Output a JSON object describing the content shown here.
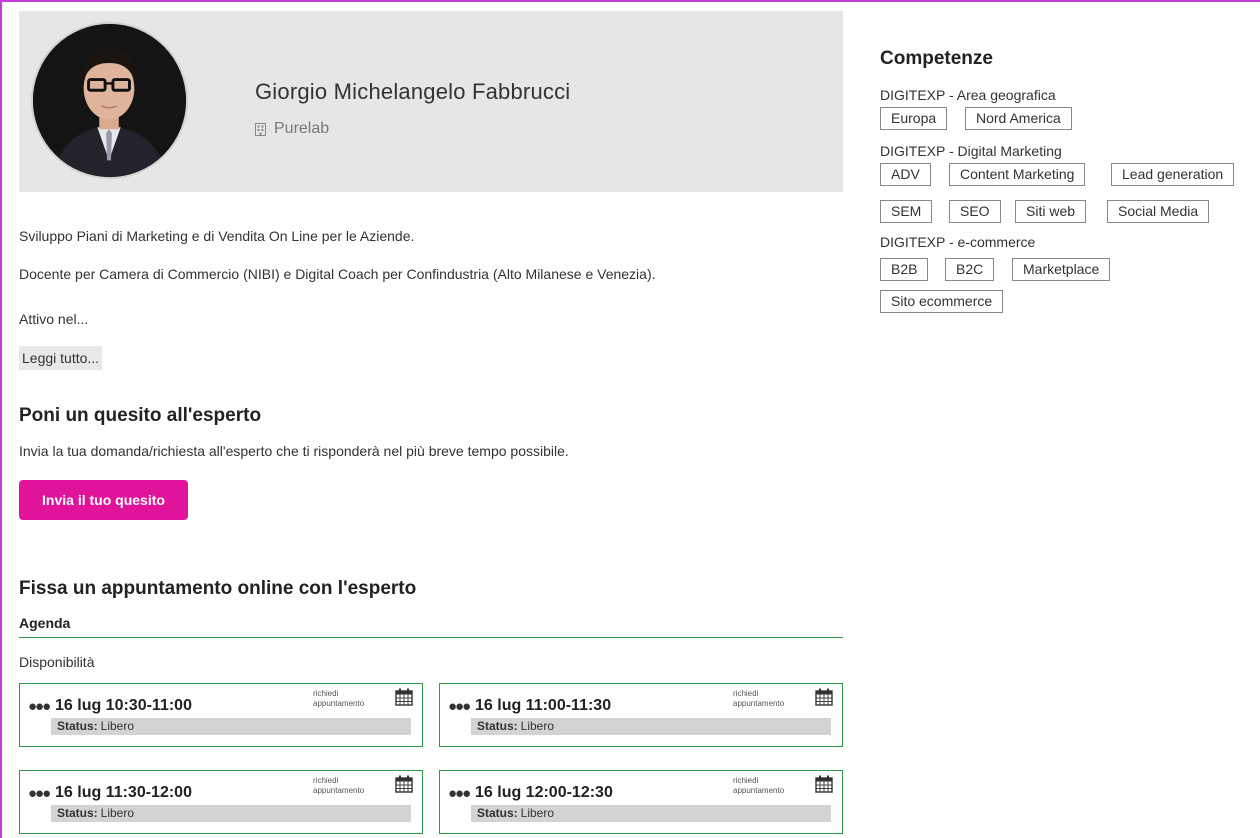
{
  "profile": {
    "name": "Giorgio Michelangelo Fabbrucci",
    "company": "Purelab",
    "company_icon": "building-icon"
  },
  "bio": {
    "line1": "Sviluppo Piani di Marketing e di Vendita On Line per le Aziende.",
    "line2": "Docente per Camera di Commercio (NIBI) e Digital Coach per Confindustria (Alto Milanese e Venezia).",
    "line3": "Attivo nel...",
    "read_more": "Leggi tutto..."
  },
  "ask": {
    "title": "Poni un quesito all'esperto",
    "description": "Invia la tua domanda/richiesta all'esperto che ti risponderà nel più breve tempo possibile.",
    "button": "Invia il tuo quesito",
    "button_color": "#e0139a"
  },
  "appointment": {
    "title": "Fissa un appuntamento online con l'esperto",
    "agenda_label": "Agenda",
    "availability_label": "Disponibilità",
    "accent_color": "#2e9b4a",
    "slots": [
      {
        "time": "16 lug 10:30-11:00",
        "request_line1": "richiedi",
        "request_line2": "appuntamento",
        "status_label": "Status:",
        "status_value": "Libero"
      },
      {
        "time": "16 lug 11:00-11:30",
        "request_line1": "richiedi",
        "request_line2": "appuntamento",
        "status_label": "Status:",
        "status_value": "Libero"
      },
      {
        "time": "16 lug 11:30-12:00",
        "request_line1": "richiedi",
        "request_line2": "appuntamento",
        "status_label": "Status:",
        "status_value": "Libero"
      },
      {
        "time": "16 lug 12:00-12:30",
        "request_line1": "richiedi",
        "request_line2": "appuntamento",
        "status_label": "Status:",
        "status_value": "Libero"
      }
    ]
  },
  "skills": {
    "title": "Competenze",
    "categories": [
      {
        "name": "DIGITEXP - Area geografica",
        "tags": [
          "Europa",
          "Nord America"
        ]
      },
      {
        "name": "DIGITEXP - Digital Marketing",
        "tags": [
          "ADV",
          "Content Marketing",
          "Lead generation",
          "SEM",
          "SEO",
          "Siti web",
          "Social Media"
        ]
      },
      {
        "name": "DIGITEXP - e-commerce",
        "tags": [
          "B2B",
          "B2C",
          "Marketplace",
          "Sito ecommerce"
        ]
      }
    ]
  }
}
